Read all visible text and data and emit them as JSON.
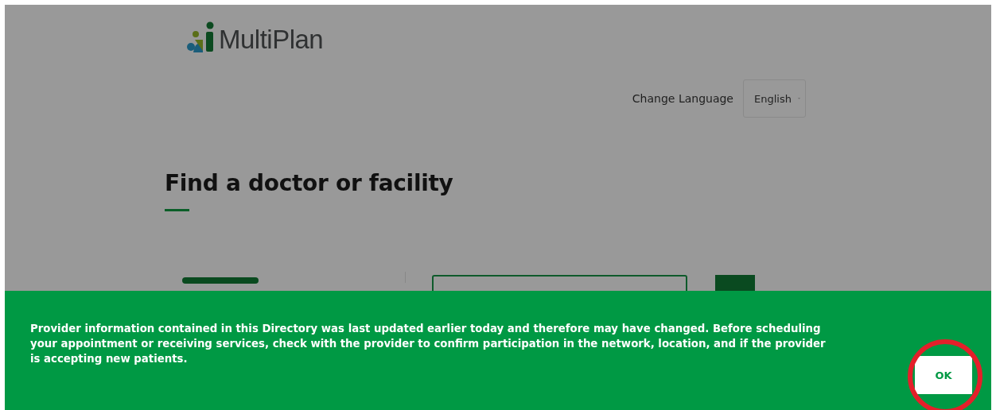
{
  "header": {
    "logo_text": "MultiPlan",
    "language_label": "Change Language",
    "language_select": {
      "value": "English"
    }
  },
  "main": {
    "heading": "Find a doctor or facility"
  },
  "notice_banner": {
    "message": "Provider information contained in this Directory was last updated earlier today and therefore may have changed. Before scheduling your appointment or receiving services, check with the provider to confirm participation in the network, location, and if the provider is accepting new patients.",
    "button": "OK"
  }
}
